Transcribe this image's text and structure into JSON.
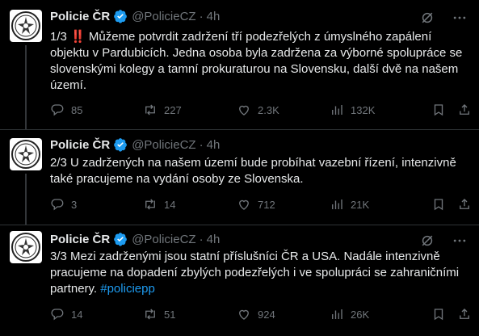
{
  "author": {
    "name": "Policie ČR",
    "handle": "@PolicieCZ",
    "time": "4h"
  },
  "tweets": [
    {
      "text": "1/3 ‼️ Můžeme potvrdit zadržení tří podezřelých z úmyslného zapálení objektu v Pardubicích. Jedna osoba byla zadržena za výborné spolupráce se slovenskými kolegy a tamní prokuraturou na Slovensku, další dvě na našem území.",
      "hashtag": "",
      "replies": "85",
      "reposts": "227",
      "likes": "2.3K",
      "views": "132K"
    },
    {
      "text": "2/3 U zadržených na našem území bude probíhat vazební řízení, intenzivně také pracujeme na vydání osoby ze Slovenska.",
      "hashtag": "",
      "replies": "3",
      "reposts": "14",
      "likes": "712",
      "views": "21K"
    },
    {
      "text": "3/3 Mezi zadrženými jsou statní příslušníci ČR a USA. Nadále intenzivně pracujeme na dopadení zbylých podezřelých i ve spolupráci se zahraničními partnery. ",
      "hashtag": "#policiepp",
      "replies": "14",
      "reposts": "51",
      "likes": "924",
      "views": "26K"
    }
  ],
  "colors": {
    "background": "#000000",
    "text": "#e7e9ea",
    "muted": "#71767b",
    "accent": "#1d9bf0",
    "verified": "#1d9bf0"
  }
}
